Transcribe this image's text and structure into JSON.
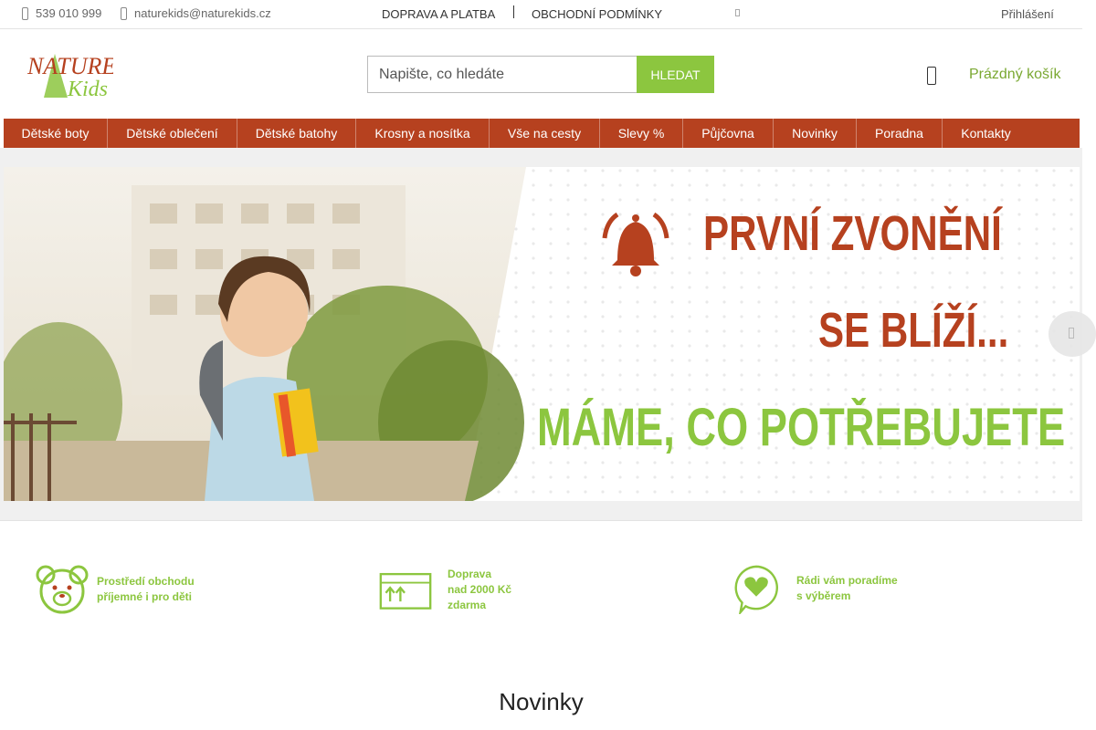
{
  "topbar": {
    "phone": "539 010 999",
    "email": "naturekids@naturekids.cz",
    "links": [
      "DOPRAVA A PLATBA",
      "OBCHODNÍ PODMÍNKY"
    ],
    "login": "Přihlášení"
  },
  "header": {
    "logo_text_1": "NATURE",
    "logo_text_2": "Kids",
    "search_placeholder": "Napište, co hledáte",
    "search_button": "HLEDAT",
    "cart_label": "Prázdný košík"
  },
  "nav": {
    "items": [
      "Dětské boty",
      "Dětské oblečení",
      "Dětské batohy",
      "Krosny a nosítka",
      "Vše na cesty",
      "Slevy %",
      "Půjčovna",
      "Novinky",
      "Poradna",
      "Kontakty"
    ]
  },
  "banner": {
    "line1": "PRVNÍ ZVONĚNÍ",
    "line2": "SE BLÍŽÍ...",
    "line3": "MÁME, CO POTŘEBUJETE"
  },
  "features": [
    {
      "text": "Prostředí obchodu\npříjemné i pro děti",
      "icon": "teddy-bear-icon"
    },
    {
      "text": "Doprava\nnad 2000 Kč\nzdarma",
      "icon": "box-icon"
    },
    {
      "text": "Rádi vám poradíme\ns výběrem",
      "icon": "heart-chat-icon"
    }
  ],
  "sections": {
    "novinky_title": "Novinky"
  },
  "colors": {
    "brand_red": "#b6411f",
    "brand_green": "#8cc63f"
  }
}
